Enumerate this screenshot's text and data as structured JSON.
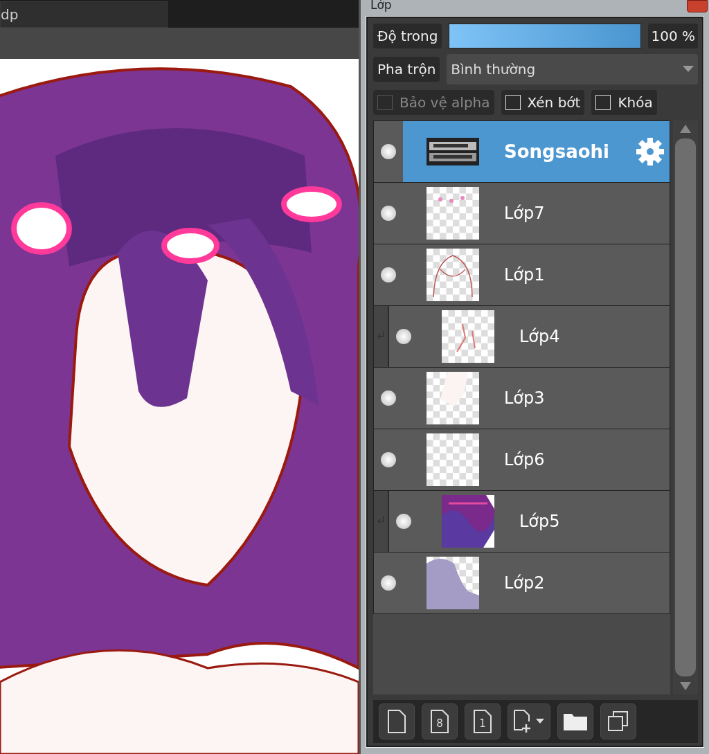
{
  "document_tab": {
    "label": "dp"
  },
  "layer_panel": {
    "title": "Lớp",
    "opacity": {
      "label": "Độ trong",
      "level": 1,
      "reading": "100 %"
    },
    "blend": {
      "label": "Pha trộn",
      "value": "Bình thường"
    },
    "options": [
      {
        "label": "Bảo vệ alpha",
        "checked": false,
        "disabled": true
      },
      {
        "label": "Xén bớt",
        "checked": false,
        "disabled": false
      },
      {
        "label": "Khóa",
        "checked": false,
        "disabled": false
      }
    ],
    "layers": [
      {
        "name": "Songsaohi",
        "visible": true,
        "selected": true,
        "clipped": false
      },
      {
        "name": "Lớp7",
        "visible": true,
        "selected": false,
        "clipped": false
      },
      {
        "name": "Lớp1",
        "visible": true,
        "selected": false,
        "clipped": false
      },
      {
        "name": "Lớp4",
        "visible": true,
        "selected": false,
        "clipped": true
      },
      {
        "name": "Lớp3",
        "visible": true,
        "selected": false,
        "clipped": false
      },
      {
        "name": "Lớp6",
        "visible": true,
        "selected": false,
        "clipped": false
      },
      {
        "name": "Lớp5",
        "visible": true,
        "selected": false,
        "clipped": true
      },
      {
        "name": "Lớp2",
        "visible": true,
        "selected": false,
        "clipped": false
      }
    ],
    "toolbar": [
      {
        "kind": "new"
      },
      {
        "kind": "numbered",
        "glyph": "8"
      },
      {
        "kind": "numbered",
        "glyph": "1"
      },
      {
        "kind": "add"
      },
      {
        "kind": "folder"
      },
      {
        "kind": "duplicate"
      }
    ]
  }
}
